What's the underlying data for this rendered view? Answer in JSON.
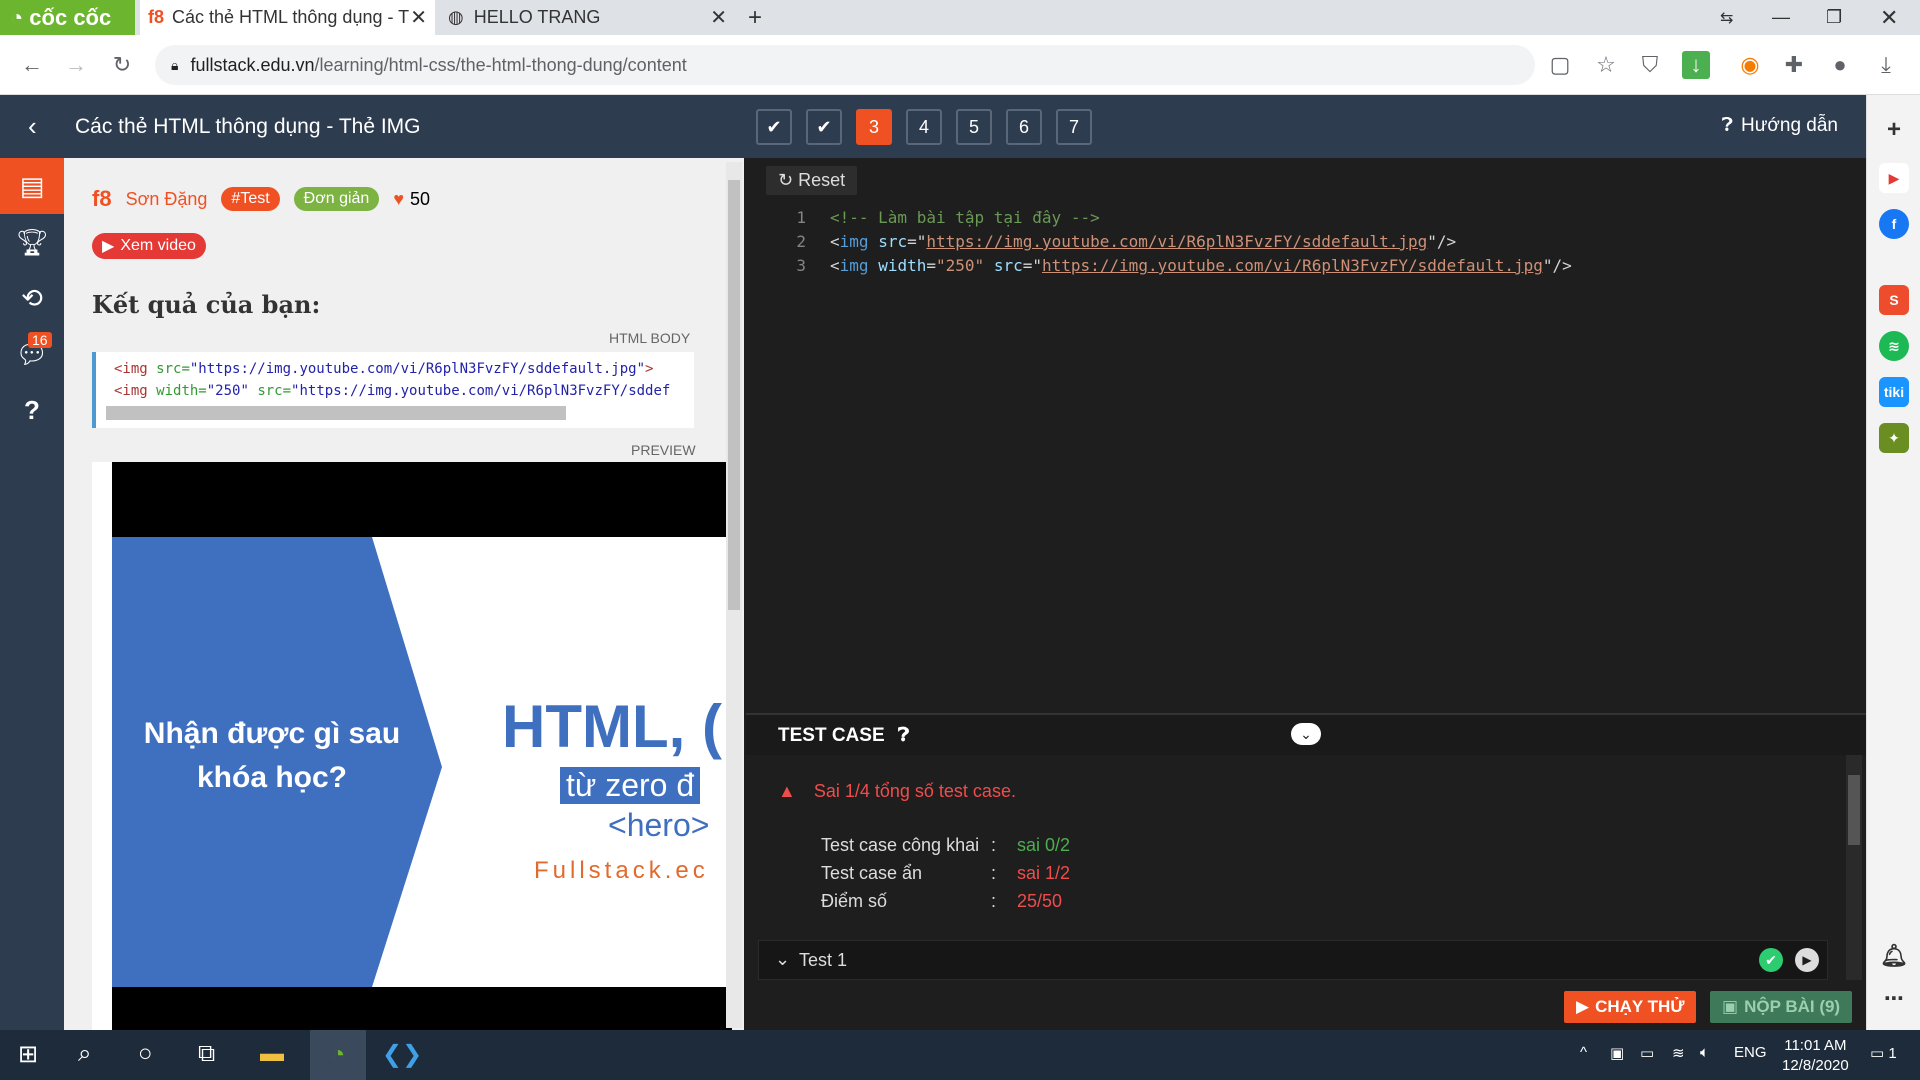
{
  "browser": {
    "brand": "cốc cốc",
    "tabs": [
      {
        "title": "Các thẻ HTML thông dụng - T"
      },
      {
        "title": "HELLO TRANG"
      }
    ],
    "url_domain": "fullstack.edu.vn",
    "url_path": "/learning/html-css/the-html-thong-dung/content"
  },
  "header": {
    "title": "Các thẻ HTML thông dụng - Thẻ IMG",
    "steps": [
      "3",
      "4",
      "5",
      "6",
      "7"
    ],
    "guide": "Hướng dẫn"
  },
  "nav": {
    "badge": "16"
  },
  "content": {
    "author": "Sơn Đặng",
    "tag_test": "#Test",
    "tag_level": "Đơn giản",
    "likes": "50",
    "video_btn": "Xem video",
    "result_title": "Kết quả của bạn:",
    "html_body_label": "HTML BODY",
    "preview_label": "PREVIEW",
    "thumbnail": {
      "question": "Nhận được gì sau khóa học?",
      "html": "HTML, (",
      "zero": "từ zero đ",
      "hero": "<hero>",
      "site": "Fullstack.ec"
    }
  },
  "editor": {
    "reset": "Reset",
    "lines": [
      "1",
      "2",
      "3"
    ]
  },
  "testcase": {
    "title": "TEST CASE",
    "error": "Sai 1/4 tổng số test case.",
    "public_label": "Test case công khai",
    "public_value": "sai 0/2",
    "hidden_label": "Test case ẩn",
    "hidden_value": "sai 1/2",
    "score_label": "Điểm số",
    "score_value": "25/50",
    "test1": "Test 1",
    "colon": ":"
  },
  "footer": {
    "run": "CHẠY THỬ",
    "submit": "NỘP BÀI (9)"
  },
  "taskbar": {
    "lang": "ENG",
    "time": "11:01 AM",
    "date": "12/8/2020",
    "notif": "1"
  },
  "colors": {
    "accent": "#f05123",
    "header_bg": "#2e3c50",
    "success": "#2ecc71"
  }
}
